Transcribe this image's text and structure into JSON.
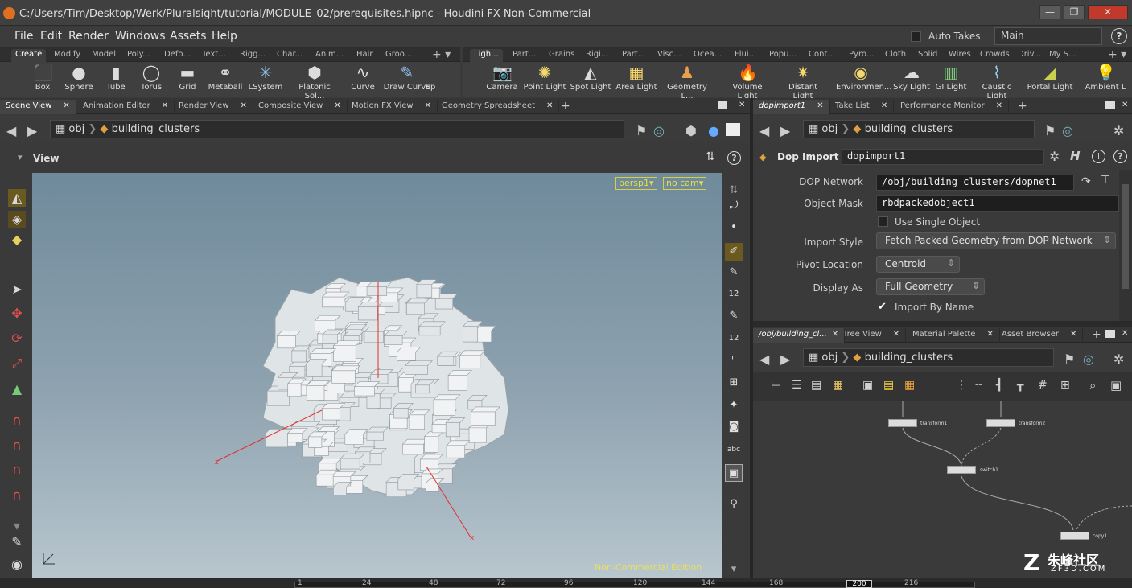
{
  "window": {
    "title": "C:/Users/Tim/Desktop/Werk/Pluralsight/tutorial/MODULE_02/prerequisites.hipnc - Houdini FX Non-Commercial",
    "buttons": [
      "—",
      "❐",
      "✕"
    ]
  },
  "menu": [
    "File",
    "Edit",
    "Render",
    "Windows",
    "Assets",
    "Help"
  ],
  "takes": {
    "auto_takes_label": "Auto Takes",
    "desktop": "Main",
    "help": "?"
  },
  "shelf_left": {
    "tabs": [
      "Create",
      "Modify",
      "Model",
      "Poly...",
      "Defo...",
      "Text...",
      "Rigg...",
      "Char...",
      "Anim...",
      "Hair",
      "Groo..."
    ],
    "tools": [
      "Box",
      "Sphere",
      "Tube",
      "Torus",
      "Grid",
      "Metaball",
      "LSystem",
      "Platonic Sol...",
      "Curve",
      "Draw Curve",
      "Sp"
    ]
  },
  "shelf_right": {
    "tabs": [
      "Ligh...",
      "Part...",
      "Grains",
      "Rigi...",
      "Part...",
      "Visc...",
      "Ocea...",
      "Flui...",
      "Popu...",
      "Cont...",
      "Pyro...",
      "Cloth",
      "Solid",
      "Wires",
      "Crowds",
      "Driv...",
      "My S..."
    ],
    "tools": [
      "Camera",
      "Point Light",
      "Spot Light",
      "Area Light",
      "Geometry L...",
      "Volume Light",
      "Distant Light",
      "Environmen...",
      "Sky Light",
      "GI Light",
      "Caustic Light",
      "Portal Light",
      "Ambient L"
    ]
  },
  "left_pane": {
    "tabs": [
      "Scene View",
      "Animation Editor",
      "Render View",
      "Composite View",
      "Motion FX View",
      "Geometry Spreadsheet"
    ],
    "path_root": "obj",
    "path_node": "building_clusters",
    "view_label": "View",
    "persp": "persp1",
    "cam": "no cam",
    "watermark": "Non-Commercial Edition",
    "axes": {
      "x": "x",
      "z": "z"
    },
    "side_tools": [
      "12",
      "12",
      "abc"
    ]
  },
  "params_pane": {
    "tabs": [
      "dopimport1",
      "Take List",
      "Performance Monitor"
    ],
    "path_root": "obj",
    "path_node": "building_clusters",
    "node_type": "Dop Import",
    "node_name": "dopimport1",
    "params": {
      "dop_network_label": "DOP Network",
      "dop_network_value": "/obj/building_clusters/dopnet1",
      "object_mask_label": "Object Mask",
      "object_mask_value": "rbdpackedobject1",
      "use_single_label": "Use Single Object",
      "import_style_label": "Import Style",
      "import_style_value": "Fetch Packed Geometry from DOP Network",
      "pivot_label": "Pivot Location",
      "pivot_value": "Centroid",
      "display_label": "Display As",
      "display_value": "Full Geometry",
      "import_name_label": "Import By Name"
    }
  },
  "network_pane": {
    "tabs": [
      "/obj/building_cl...",
      "Tree View",
      "Material Palette",
      "Asset Browser"
    ],
    "path_root": "obj",
    "path_node": "building_clusters",
    "nodes": [
      "transform1",
      "transform2",
      "switch1",
      "copy1"
    ]
  },
  "timeline": {
    "ticks": [
      "1",
      "24",
      "48",
      "72",
      "96",
      "120",
      "144",
      "168",
      "216"
    ],
    "current": "200"
  },
  "brand": {
    "logo_text": "朱峰社区",
    "site": "ZF3D.COM"
  }
}
